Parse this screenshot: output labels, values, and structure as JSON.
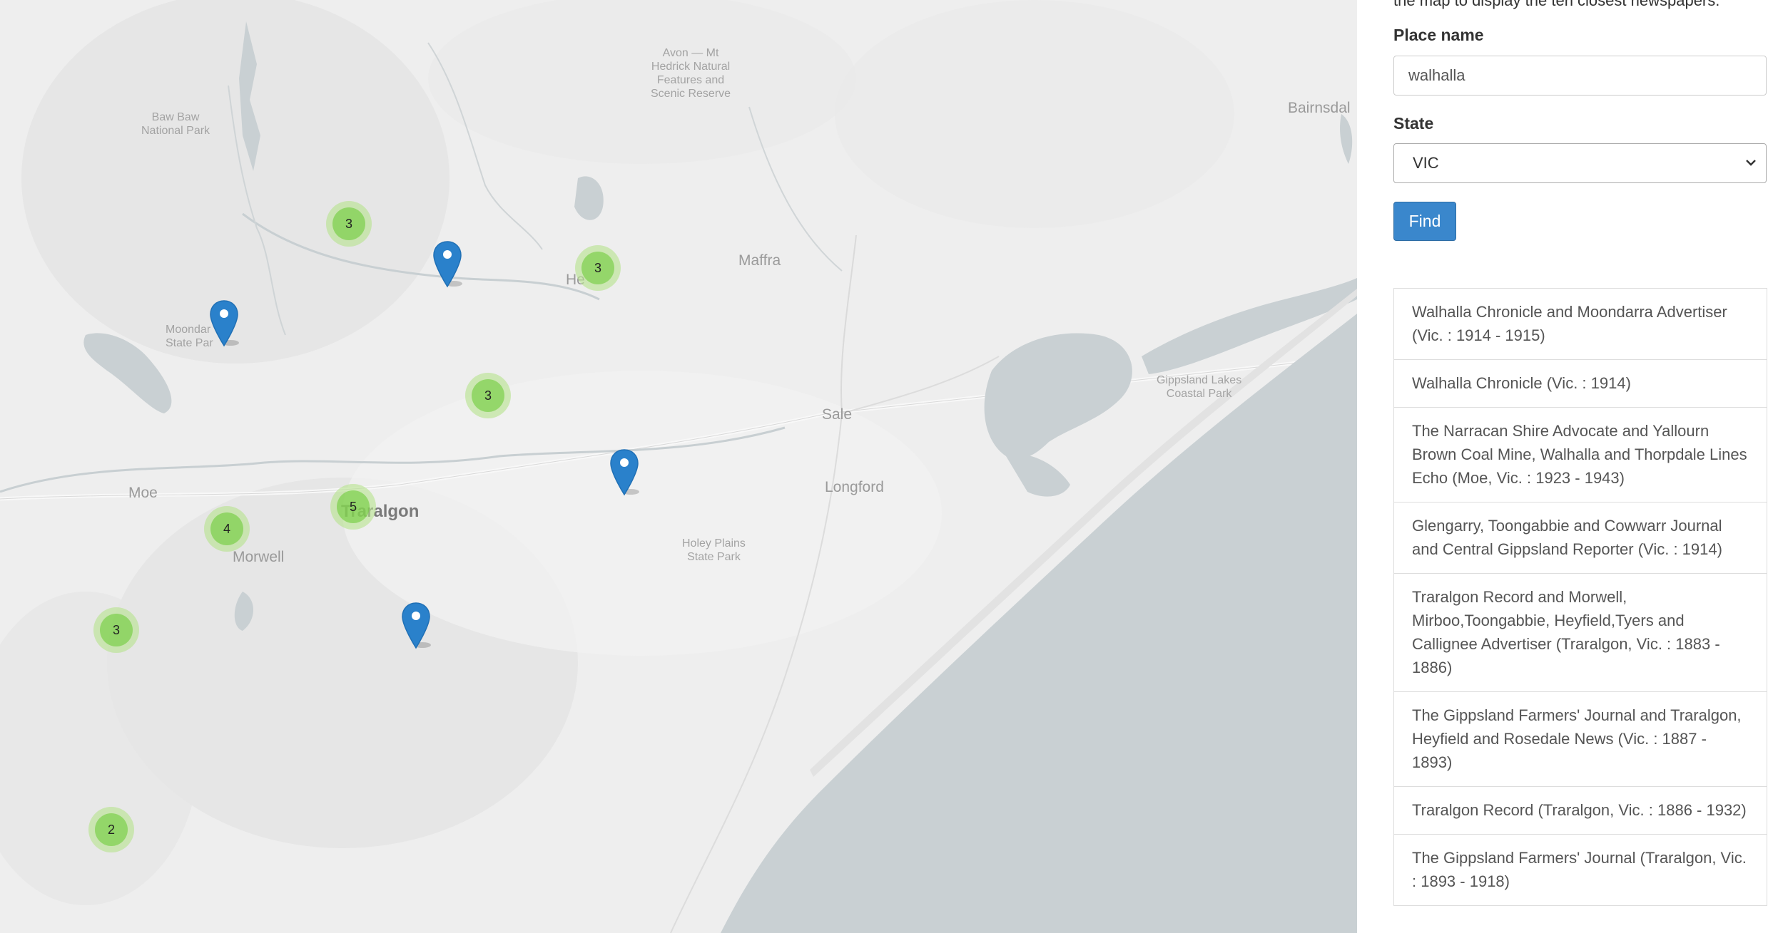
{
  "map": {
    "place_labels": {
      "baw_baw": "Baw Baw\nNational Park",
      "avon": "Avon — Mt\nHedrick Natural\nFeatures and\nScenic Reserve",
      "bairnsdale": "Bairnsdal",
      "moondarra": "Moondar\nState Par",
      "maffra": "Maffra",
      "heyfield": "He",
      "sale": "Sale",
      "longford": "Longford",
      "moe": "Moe",
      "traralgon": "Traralgon",
      "morwell": "Morwell",
      "holey_plains": "Holey Plains\nState Park",
      "gippsland_lakes": "Gippsland Lakes\nCoastal Park"
    },
    "clusters": [
      {
        "id": "c1",
        "count": "3"
      },
      {
        "id": "c2",
        "count": "3"
      },
      {
        "id": "c3",
        "count": "3"
      },
      {
        "id": "c4",
        "count": "5"
      },
      {
        "id": "c5",
        "count": "4"
      },
      {
        "id": "c6",
        "count": "3"
      },
      {
        "id": "c7",
        "count": "2"
      }
    ],
    "colors": {
      "marker": "#2a81cb",
      "cluster_outer": "#b5e28c",
      "cluster_inner": "#6ecc39",
      "water": "#c9d0d3",
      "land": "#eeeeee"
    }
  },
  "sidebar": {
    "intro_text": "the map to display the ten closest newspapers.",
    "place_label": "Place name",
    "place_value": "walhalla",
    "state_label": "State",
    "state_value": "VIC",
    "find_label": "Find",
    "results": [
      "Walhalla Chronicle and Moondarra Advertiser (Vic. : 1914 - 1915)",
      "Walhalla Chronicle (Vic. : 1914)",
      "The Narracan Shire Advocate and Yallourn Brown Coal Mine, Walhalla and Thorpdale Lines Echo (Moe, Vic. : 1923 - 1943)",
      "Glengarry, Toongabbie and Cowwarr Journal and Central Gippsland Reporter (Vic. : 1914)",
      "Traralgon Record and Morwell, Mirboo,Toongabbie, Heyfield,Tyers and Callignee Advertiser (Traralgon, Vic. : 1883 - 1886)",
      "The Gippsland Farmers' Journal and Traralgon, Heyfield and Rosedale News (Vic. : 1887 - 1893)",
      "Traralgon Record (Traralgon, Vic. : 1886 - 1932)",
      "The Gippsland Farmers' Journal (Traralgon, Vic. : 1893 - 1918)"
    ]
  }
}
